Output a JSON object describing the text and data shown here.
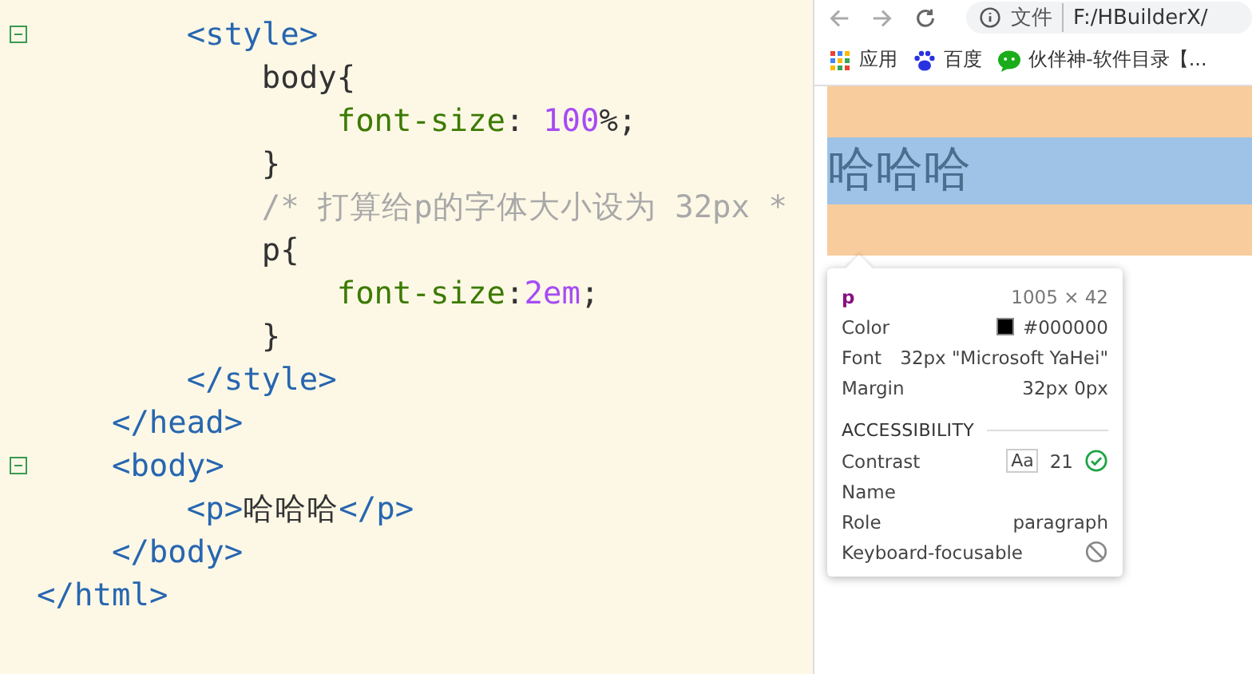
{
  "editor": {
    "lines": [
      {
        "children": [
          {
            "children": [
              {
                "fold": true,
                "tokens": [
                  {
                    "kind": "tag",
                    "text": "<style>"
                  }
                ],
                "children": [
                  {
                    "fold": false,
                    "tokens": [
                      {
                        "kind": "selector",
                        "text": "body{"
                      }
                    ],
                    "children": [
                      {
                        "fold": false,
                        "tokens": [
                          {
                            "kind": "property",
                            "text": "font-size"
                          },
                          {
                            "kind": "punct",
                            "text": ": "
                          },
                          {
                            "kind": "number",
                            "text": "100"
                          },
                          {
                            "kind": "punct",
                            "text": "%;"
                          }
                        ]
                      }
                    ]
                  },
                  {
                    "fold": false,
                    "tokens": [
                      {
                        "kind": "selector",
                        "text": "}"
                      }
                    ]
                  },
                  {
                    "fold": false,
                    "tokens": [
                      {
                        "kind": "comment",
                        "text": "/* 打算给p的字体大小设为 32px *"
                      }
                    ]
                  },
                  {
                    "fold": false,
                    "tokens": [
                      {
                        "kind": "selector",
                        "text": "p{"
                      }
                    ],
                    "children": [
                      {
                        "fold": false,
                        "tokens": [
                          {
                            "kind": "property",
                            "text": "font-size"
                          },
                          {
                            "kind": "punct",
                            "text": ":"
                          },
                          {
                            "kind": "number",
                            "text": "2em"
                          },
                          {
                            "kind": "punct",
                            "text": ";"
                          }
                        ]
                      }
                    ]
                  },
                  {
                    "fold": false,
                    "tokens": [
                      {
                        "kind": "selector",
                        "text": "}"
                      }
                    ]
                  }
                ]
              },
              {
                "fold": false,
                "tokens": [
                  {
                    "kind": "tag",
                    "text": "</style>"
                  }
                ]
              }
            ]
          },
          {
            "fold": false,
            "tokens": [
              {
                "kind": "tag",
                "text": "</head>"
              }
            ]
          },
          {
            "fold": true,
            "tokens": [
              {
                "kind": "tag",
                "text": "<body>"
              }
            ],
            "children": [
              {
                "fold": false,
                "tokens": [
                  {
                    "kind": "tag",
                    "text": "<p>"
                  },
                  {
                    "kind": "text",
                    "text": "哈哈哈"
                  },
                  {
                    "kind": "tag",
                    "text": "</p>"
                  }
                ]
              }
            ]
          },
          {
            "fold": false,
            "tokens": [
              {
                "kind": "tag",
                "text": "</body>"
              }
            ]
          }
        ]
      },
      {
        "fold": false,
        "tokens": [
          {
            "kind": "tag",
            "text": "</html>"
          }
        ]
      }
    ]
  },
  "browser": {
    "address": {
      "scheme": "文件",
      "url": "F:/HBuilderX/"
    },
    "bookmarks": [
      {
        "kind": "apps",
        "label": "应用"
      },
      {
        "kind": "paw",
        "label": "百度"
      },
      {
        "kind": "chat",
        "label": "伙伴神-软件目录【..."
      }
    ],
    "page": {
      "paragraph": "哈哈哈"
    },
    "inspector": {
      "tag": "p",
      "size": "1005 × 42",
      "rows": [
        {
          "kind": "color",
          "label": "Color",
          "value": "#000000"
        },
        {
          "kind": "text",
          "label": "Font",
          "value": "32px \"Microsoft YaHei\""
        },
        {
          "kind": "text",
          "label": "Margin",
          "value": "32px 0px"
        }
      ],
      "section": "ACCESSIBILITY",
      "a11y": [
        {
          "kind": "contrast",
          "label": "Contrast",
          "badge": "Aa",
          "value": "21"
        },
        {
          "kind": "empty",
          "label": "Name"
        },
        {
          "kind": "text",
          "label": "Role",
          "value": "paragraph"
        },
        {
          "kind": "blocked",
          "label": "Keyboard-focusable"
        }
      ]
    }
  }
}
